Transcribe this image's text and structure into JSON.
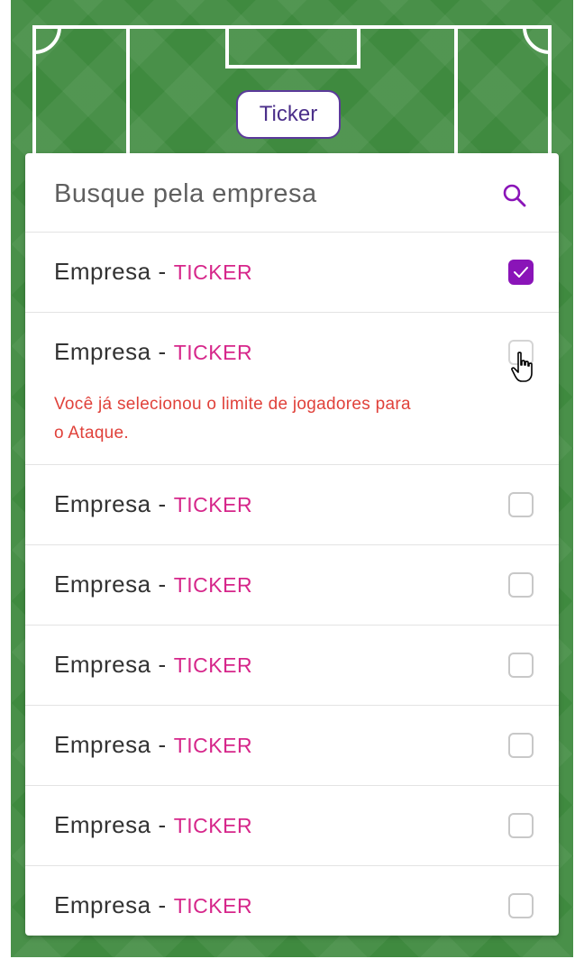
{
  "field": {
    "ticker_chip": "Ticker"
  },
  "search": {
    "placeholder": "Busque pela empresa",
    "value": ""
  },
  "colors": {
    "field_green": "#3f8a3f",
    "accent_purple": "#8a14b8",
    "ticker_pink": "#d6268a",
    "error_red": "#e0413a"
  },
  "list": [
    {
      "name": "Empresa",
      "separator": "-",
      "ticker": "TICKER",
      "checked": true
    },
    {
      "name": "Empresa",
      "separator": "-",
      "ticker": "TICKER",
      "checked": false,
      "error": "Você já selecionou o limite de jogadores para o Ataque."
    },
    {
      "name": "Empresa",
      "separator": "-",
      "ticker": "TICKER",
      "checked": false
    },
    {
      "name": "Empresa",
      "separator": "-",
      "ticker": "TICKER",
      "checked": false
    },
    {
      "name": "Empresa",
      "separator": "-",
      "ticker": "TICKER",
      "checked": false
    },
    {
      "name": "Empresa",
      "separator": "-",
      "ticker": "TICKER",
      "checked": false
    },
    {
      "name": "Empresa",
      "separator": "-",
      "ticker": "TICKER",
      "checked": false
    },
    {
      "name": "Empresa",
      "separator": "-",
      "ticker": "TICKER",
      "checked": false
    }
  ],
  "icons": {
    "search": "search-icon",
    "check": "check-icon",
    "cursor": "hand-pointer-icon"
  }
}
